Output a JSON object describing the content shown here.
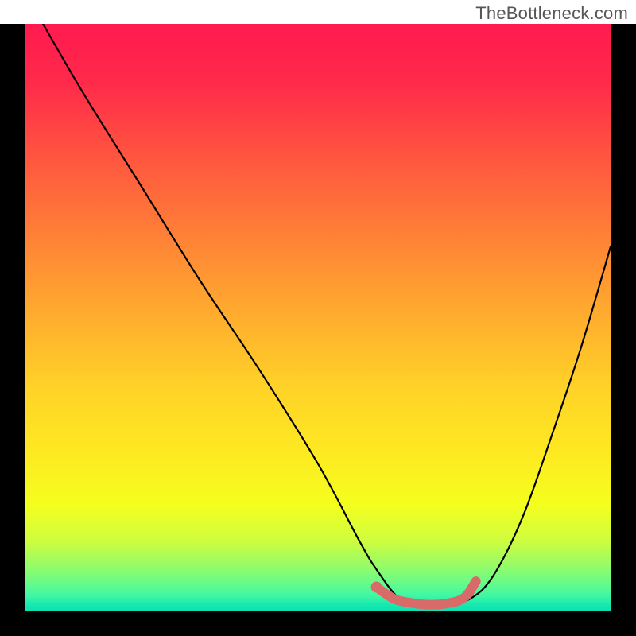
{
  "watermark": "TheBottleneck.com",
  "chart_data": {
    "type": "line",
    "title": "",
    "xlabel": "",
    "ylabel": "",
    "xlim": [
      0,
      100
    ],
    "ylim": [
      0,
      100
    ],
    "grid": false,
    "series": [
      {
        "name": "bottleneck-curve",
        "color": "#000000",
        "x": [
          3,
          10,
          20,
          30,
          40,
          50,
          57,
          60,
          64,
          68,
          72,
          76,
          80,
          85,
          90,
          95,
          100
        ],
        "y": [
          100,
          88,
          72,
          56,
          41,
          25,
          12,
          7,
          2,
          1,
          1,
          2,
          6,
          16,
          30,
          45,
          62
        ]
      }
    ],
    "annotations": [
      {
        "name": "optimal-range-marker",
        "color": "#d86a6a",
        "x": [
          60,
          63,
          66,
          69,
          72,
          75,
          77
        ],
        "y": [
          4,
          2,
          1.3,
          1,
          1.2,
          2.2,
          5
        ]
      }
    ],
    "gradient_stops": [
      {
        "pos": 0,
        "color": "#ff1a4f"
      },
      {
        "pos": 35,
        "color": "#ff7d37"
      },
      {
        "pos": 62,
        "color": "#ffd227"
      },
      {
        "pos": 82,
        "color": "#f4ff1e"
      },
      {
        "pos": 95,
        "color": "#6cfb86"
      },
      {
        "pos": 100,
        "color": "#0ee0b2"
      }
    ]
  }
}
